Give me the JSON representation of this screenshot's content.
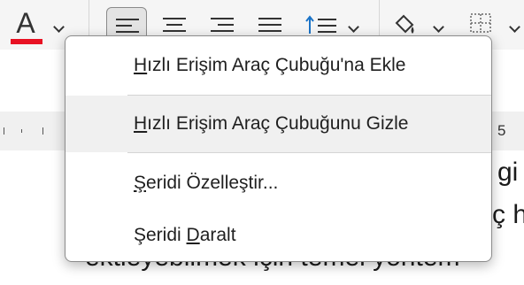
{
  "ribbon": {
    "font_color": {
      "letter": "A",
      "color": "#e81123"
    },
    "ruler_number": "5"
  },
  "document": {
    "line1_fragment": "gi",
    "line2_fragment": "ç h",
    "line3_fragment": "ektleyebilmek için temel yöntem"
  },
  "context_menu": {
    "items": [
      {
        "accel": "H",
        "rest": "ızlı Erişim Araç Çubuğu'na Ekle"
      },
      {
        "accel": "H",
        "rest": "ızlı Erişim Araç Çubuğunu Gizle"
      },
      {
        "pre": "Ş",
        "rest": "eridi Özelleştir..."
      },
      {
        "pre": "Şeridi ",
        "accel": "D",
        "rest": "aralt"
      }
    ]
  }
}
